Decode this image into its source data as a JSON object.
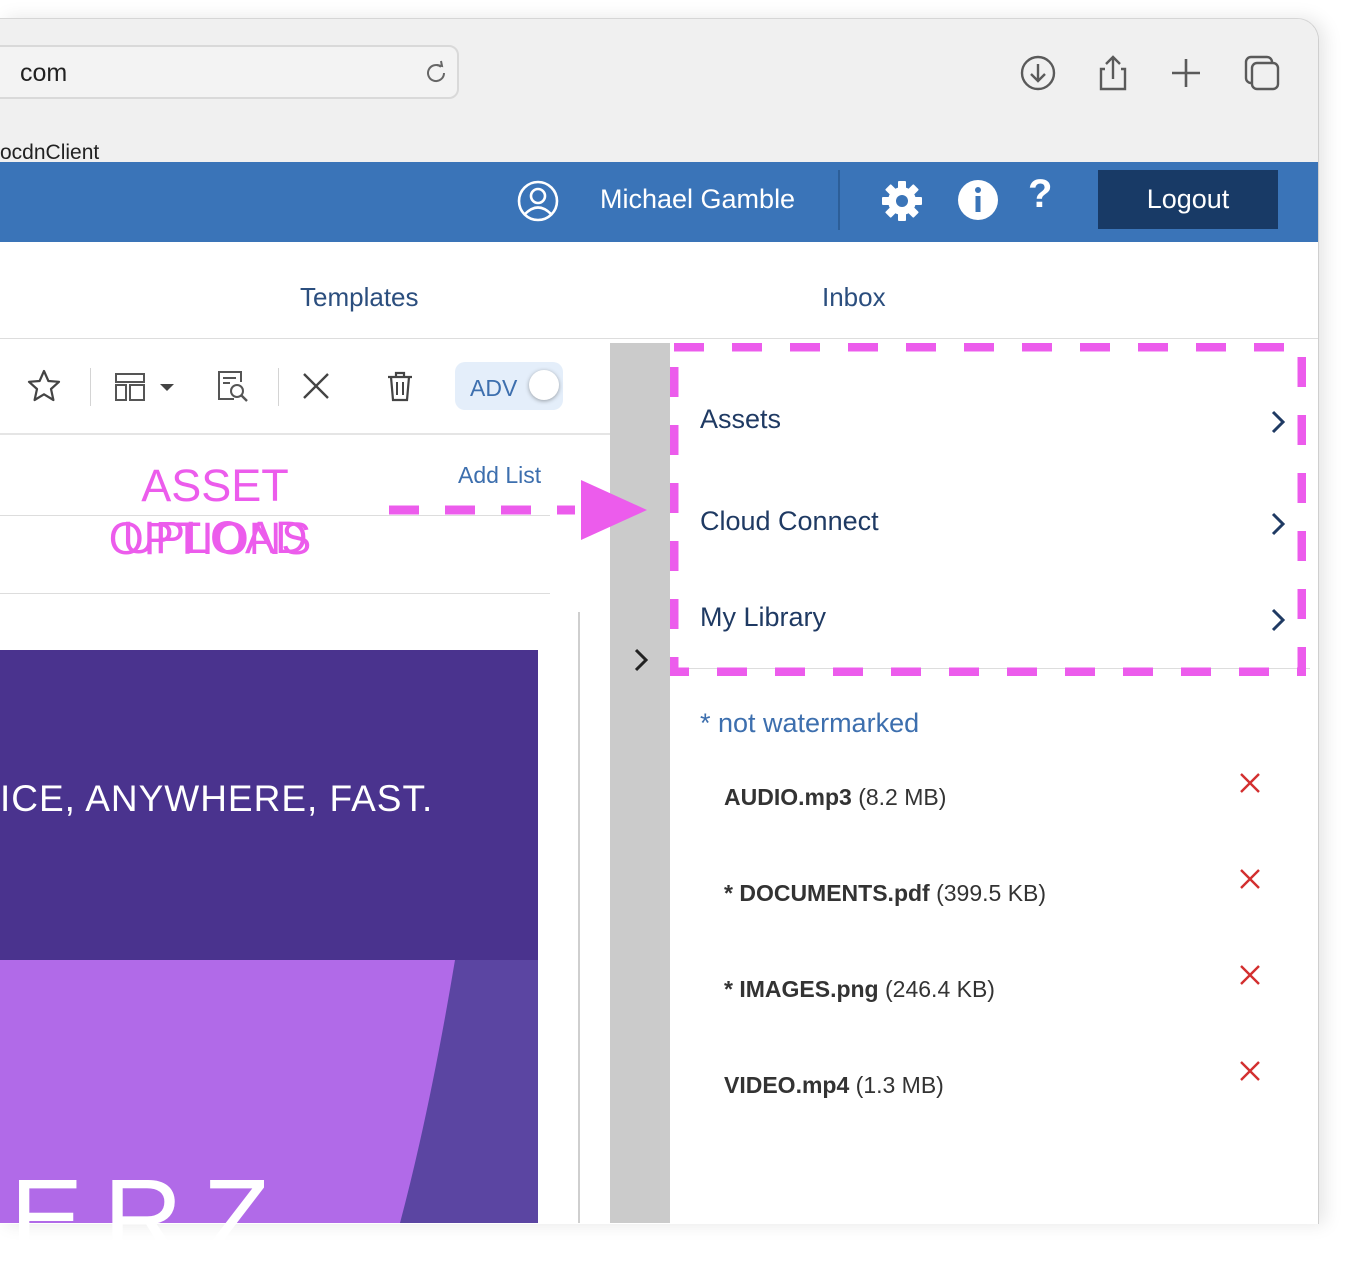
{
  "browser": {
    "url_text": "com",
    "tab_text": "ocdnClient"
  },
  "appbar": {
    "user_name": "Michael Gamble",
    "help_label": "?",
    "logout_label": "Logout"
  },
  "tabs": [
    {
      "label": "Templates"
    },
    {
      "label": "Inbox"
    }
  ],
  "editor_toolbar": {
    "adv_label": "ADV",
    "adv_enabled": false,
    "add_list_label": "Add List"
  },
  "canvas": {
    "banner_text": "ICE, ANYWHERE, FAST.",
    "hero_text": "ERZ",
    "banner_color": "#4a338e",
    "hero_color": "#b16ae8"
  },
  "panel": {
    "items": [
      {
        "label": "Assets"
      },
      {
        "label": "Cloud Connect"
      },
      {
        "label": "My Library"
      }
    ],
    "watermark_note": "* not watermarked",
    "files": [
      {
        "name": "AUDIO.mp3",
        "size": "(8.2 MB)"
      },
      {
        "name": "* DOCUMENTS.pdf",
        "size": "(399.5 KB)"
      },
      {
        "name": "* IMAGES.png",
        "size": "(246.4 KB)"
      },
      {
        "name": "VIDEO.mp4",
        "size": "(1.3 MB)"
      }
    ]
  },
  "annotation": {
    "line1": "ASSET UPLOAD",
    "line2": "OPTIONS",
    "color": "#ec5cec"
  },
  "colors": {
    "appbar": "#3a74b8",
    "logout": "#183a66",
    "link": "#3d6fae",
    "delete": "#d32f2f"
  }
}
